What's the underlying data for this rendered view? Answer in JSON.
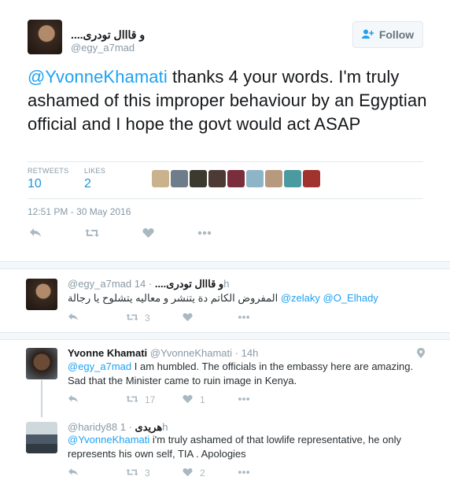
{
  "tweet": {
    "author_name": "و قااال تودرى....",
    "author_handle": "@egy_a7mad",
    "follow_label": "Follow",
    "mention": "@YvonneKhamati",
    "text": " thanks 4 your words. I'm truly ashamed of this improper behaviour by an Egyptian official and I hope the govt would act ASAP",
    "retweets_label": "RETWEETS",
    "retweets_count": "10",
    "likes_label": "LIKES",
    "likes_count": "2",
    "timestamp": "12:51 PM - 30 May 2016",
    "liker_colors": [
      "#c9b28c",
      "#6f7c89",
      "#3c3a2e",
      "#4d3a35",
      "#7a2d3a",
      "#8eb5c7",
      "#b79a7e",
      "#4a9aa0",
      "#a0332d"
    ]
  },
  "reply1": {
    "handle": "@egy_a7mad",
    "name": "و قااال تودرى....",
    "time": "14h",
    "text": "المفروض الكاتم دة يتنشر و معاليه يتشلوح يا رجالة",
    "mention1": "@zelaky",
    "mention2": "@O_Elhady",
    "retweet_count": "3"
  },
  "thread": {
    "reply2": {
      "name": "Yvonne Khamati",
      "handle": "@YvonneKhamati",
      "time": "14h",
      "mention": "@egy_a7mad",
      "text": " I am humbled. The officials in the embassy here are amazing. Sad that the Minister came to ruin image in Kenya.",
      "retweet_count": "17",
      "like_count": "1"
    },
    "reply3": {
      "handle": "@haridy88",
      "name": "هريدى",
      "time": "1h",
      "mention": "@YvonneKhamati",
      "text": " i'm truly ashamed of that lowlife representative, he only represents his own self, TIA . Apologies",
      "retweet_count": "3",
      "like_count": "2"
    }
  },
  "icons": {
    "reply": "reply-icon",
    "retweet": "retweet-icon",
    "like": "heart-icon",
    "more": "more-icon",
    "location": "location-icon",
    "follow": "add-user-icon"
  },
  "colors": {
    "accent": "#1da1f2",
    "link": "#1b95e0",
    "muted": "#8899a6"
  }
}
